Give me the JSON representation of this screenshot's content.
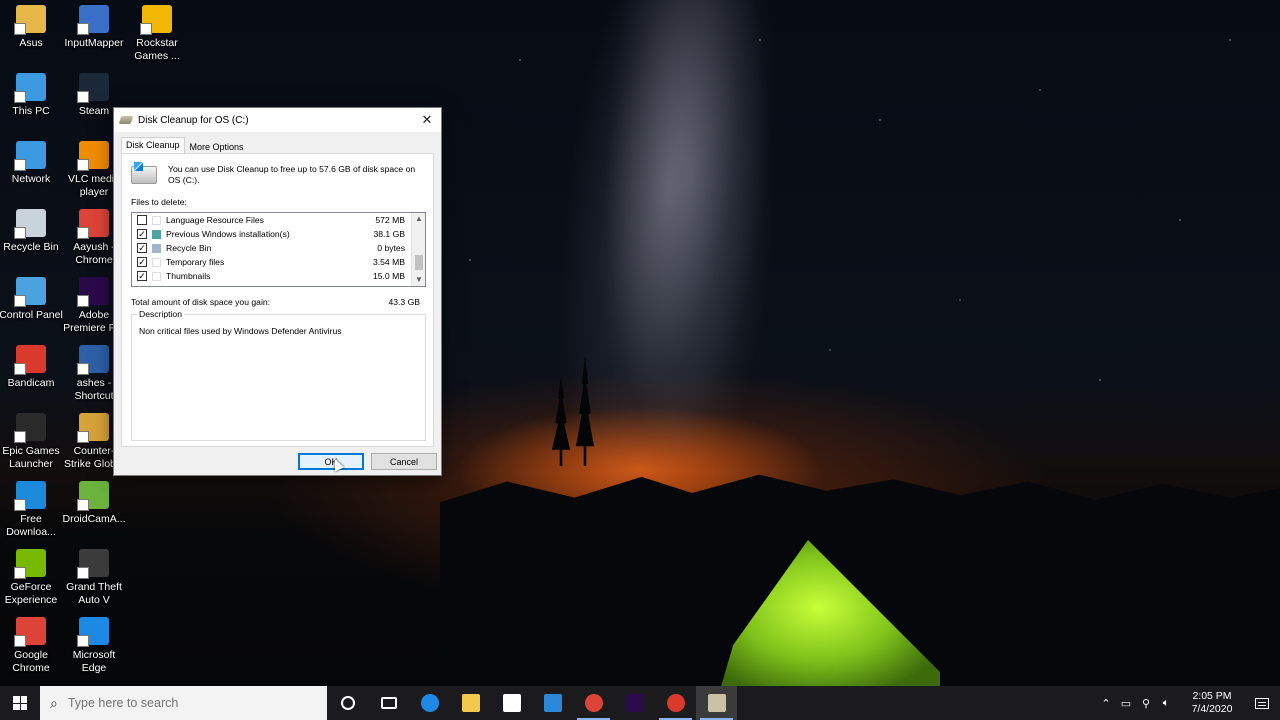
{
  "desktop": {
    "icons": [
      {
        "label": "Asus",
        "icon": "folder-icon",
        "color": "#e6b84a"
      },
      {
        "label": "InputMapper",
        "icon": "inputmapper-icon",
        "color": "#3a6fc8"
      },
      {
        "label": "Rockstar Games ...",
        "icon": "rockstar-icon",
        "color": "#f2b705"
      },
      {
        "label": "This PC",
        "icon": "computer-icon",
        "color": "#3b9ae1"
      },
      {
        "label": "Steam",
        "icon": "steam-icon",
        "color": "#1b2838"
      },
      {
        "label": "Network",
        "icon": "network-icon",
        "color": "#3b9ae1"
      },
      {
        "label": "VLC media player",
        "icon": "vlc-icon",
        "color": "#f08c00"
      },
      {
        "label": "Recycle Bin",
        "icon": "recycle-bin-icon",
        "color": "#c9d3dc"
      },
      {
        "label": "Aayush - Chrome",
        "icon": "chrome-icon",
        "color": "#db4437"
      },
      {
        "label": "Control Panel",
        "icon": "control-panel-icon",
        "color": "#4aa3df"
      },
      {
        "label": "Adobe Premiere Pro",
        "icon": "premiere-icon",
        "color": "#2a0a4a"
      },
      {
        "label": "Bandicam",
        "icon": "bandicam-icon",
        "color": "#d93a2b"
      },
      {
        "label": "ashes - Shortcut",
        "icon": "ashes-icon",
        "color": "#2d5fa8"
      },
      {
        "label": "Epic Games Launcher",
        "icon": "epic-games-icon",
        "color": "#2a2a2a"
      },
      {
        "label": "Counter-Strike Global Offensive",
        "icon": "csgo-icon",
        "color": "#d6a23a"
      },
      {
        "label": "Free Downloa...",
        "icon": "free-download-icon",
        "color": "#1c8adb"
      },
      {
        "label": "DroidCamA...",
        "icon": "droidcam-icon",
        "color": "#6bb33c"
      },
      {
        "label": "GeForce Experience",
        "icon": "geforce-icon",
        "color": "#76b900"
      },
      {
        "label": "Grand Theft Auto V",
        "icon": "gta-icon",
        "color": "#3b3b3b"
      },
      {
        "label": "Google Chrome",
        "icon": "chrome-icon",
        "color": "#db4437"
      },
      {
        "label": "Microsoft Edge",
        "icon": "edge-icon",
        "color": "#1e88e5"
      }
    ]
  },
  "dialog": {
    "title": "Disk Cleanup for OS (C:)",
    "close_glyph": "✕",
    "tabs": [
      {
        "label": "Disk Cleanup",
        "active": true
      },
      {
        "label": "More Options",
        "active": false
      }
    ],
    "intro": "You can use Disk Cleanup to free up to 57.6 GB of disk space on OS (C:).",
    "files_label": "Files to delete:",
    "files": [
      {
        "name": "Language Resource Files",
        "size": "572 MB",
        "checked": false,
        "icon": "blank-file-icon"
      },
      {
        "name": "Previous Windows installation(s)",
        "size": "38.1 GB",
        "checked": true,
        "icon": "windows-installation-icon"
      },
      {
        "name": "Recycle Bin",
        "size": "0 bytes",
        "checked": true,
        "icon": "recycle-bin-icon"
      },
      {
        "name": "Temporary files",
        "size": "3.54 MB",
        "checked": true,
        "icon": "blank-file-icon"
      },
      {
        "name": "Thumbnails",
        "size": "15.0 MB",
        "checked": true,
        "icon": "blank-file-icon"
      }
    ],
    "total_label": "Total amount of disk space you gain:",
    "total_value": "43.3 GB",
    "description_label": "Description",
    "description_text": "Non critical files used by Windows Defender Antivirus",
    "ok_label": "OK",
    "cancel_label": "Cancel"
  },
  "taskbar": {
    "search_placeholder": "Type here to search",
    "pinned": [
      {
        "icon": "cortana-icon",
        "color": "#ffffff",
        "running": false
      },
      {
        "icon": "task-view-icon",
        "color": "#ffffff",
        "running": false
      },
      {
        "icon": "edge-icon",
        "color": "#1e88e5",
        "running": false
      },
      {
        "icon": "file-explorer-icon",
        "color": "#f2c94c",
        "running": false
      },
      {
        "icon": "store-icon",
        "color": "#ffffff",
        "running": false
      },
      {
        "icon": "mail-icon",
        "color": "#2b88d8",
        "running": false
      },
      {
        "icon": "chrome-icon",
        "color": "#db4437",
        "running": true
      },
      {
        "icon": "premiere-icon",
        "color": "#2a0a4a",
        "running": false
      },
      {
        "icon": "bandicam-icon",
        "color": "#d93a2b",
        "running": true
      },
      {
        "icon": "disk-cleanup-icon",
        "color": "#c9c2a8",
        "running": true
      }
    ],
    "time": "2:05 PM",
    "date": "7/4/2020"
  },
  "colors": {
    "accent": "#0078d7",
    "taskbar": "#1c1c1e"
  }
}
